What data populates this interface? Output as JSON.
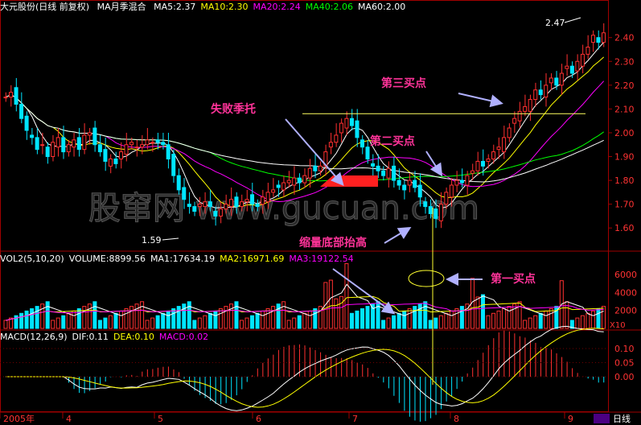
{
  "header": {
    "stock": "大元股份(日线 前复权)",
    "indicator": "MA月季混合",
    "items": [
      {
        "label": "MA5:2.37",
        "color": "#ffffff"
      },
      {
        "label": "MA10:2.30",
        "color": "#ffff00"
      },
      {
        "label": "MA20:2.24",
        "color": "#ff00ff"
      },
      {
        "label": "MA40:2.06",
        "color": "#00ff00"
      },
      {
        "label": "MA60:2.00",
        "color": "#ffffff"
      }
    ]
  },
  "volume_header": {
    "items": [
      {
        "label": "VOL2(5,10,20)",
        "color": "#ffffff"
      },
      {
        "label": "VOLUME:8899.56",
        "color": "#ffffff"
      },
      {
        "label": "MA1:17634.19",
        "color": "#ffffff"
      },
      {
        "label": "MA2:16971.69",
        "color": "#ffff00"
      },
      {
        "label": "MA3:19122.54",
        "color": "#ff00ff"
      }
    ]
  },
  "macd_header": {
    "items": [
      {
        "label": "MACD(12,26,9)",
        "color": "#ffffff"
      },
      {
        "label": "DIF:0.11",
        "color": "#ffffff"
      },
      {
        "label": "DEA:0.10",
        "color": "#ffff00"
      },
      {
        "label": "MACD:0.02",
        "color": "#ff00ff"
      }
    ]
  },
  "chart_data": {
    "type": "candlestick",
    "price_axis": {
      "ticks": [
        "2.40",
        "2.30",
        "2.20",
        "2.10",
        "2.00",
        "1.90",
        "1.80",
        "1.70",
        "1.60"
      ],
      "range": [
        1.55,
        2.47
      ]
    },
    "volume_axis": {
      "ticks": [
        "6000",
        "4000",
        "2000"
      ],
      "unit": "X10"
    },
    "macd_axis": {
      "ticks": [
        "0.10",
        "0.05",
        "0.00"
      ]
    },
    "x_ticks": [
      "2005年",
      "4",
      "5",
      "6",
      "7",
      "8",
      "9"
    ],
    "period_label": "日线",
    "high_label": "2.47",
    "low_label": "1.59",
    "support_level": 2.08,
    "annotations": [
      "失败季托",
      "第二买点",
      "第三买点",
      "缩量底部抬高",
      "第一买点"
    ],
    "watermark": "股窜网 www.gucuan.com",
    "price_series": [
      2.15,
      2.17,
      2.12,
      2.06,
      2.01,
      1.98,
      1.93,
      1.95,
      1.9,
      1.96,
      1.98,
      1.92,
      1.95,
      1.97,
      1.93,
      1.99,
      2.0,
      1.95,
      1.92,
      1.88,
      1.89,
      1.87,
      1.92,
      1.95,
      1.96,
      1.94,
      1.95,
      1.97,
      1.96,
      1.96,
      1.95,
      1.89,
      1.82,
      1.76,
      1.72,
      1.69,
      1.67,
      1.7,
      1.71,
      1.69,
      1.65,
      1.68,
      1.7,
      1.72,
      1.69,
      1.71,
      1.72,
      1.7,
      1.69,
      1.73,
      1.75,
      1.76,
      1.77,
      1.79,
      1.8,
      1.81,
      1.79,
      1.82,
      1.85,
      1.84,
      1.86,
      1.92,
      1.96,
      1.99,
      2.04,
      2.06,
      2.03,
      1.98,
      1.94,
      1.89,
      1.86,
      1.84,
      1.82,
      1.85,
      1.8,
      1.78,
      1.76,
      1.8,
      1.77,
      1.73,
      1.69,
      1.66,
      1.64,
      1.7,
      1.75,
      1.78,
      1.8,
      1.79,
      1.82,
      1.84,
      1.88,
      1.86,
      1.89,
      1.92,
      1.94,
      1.98,
      2.02,
      2.06,
      2.09,
      2.11,
      2.14,
      2.18,
      2.16,
      2.2,
      2.23,
      2.2,
      2.25,
      2.28,
      2.25,
      2.3,
      2.33,
      2.36,
      2.41,
      2.38,
      2.42
    ]
  }
}
